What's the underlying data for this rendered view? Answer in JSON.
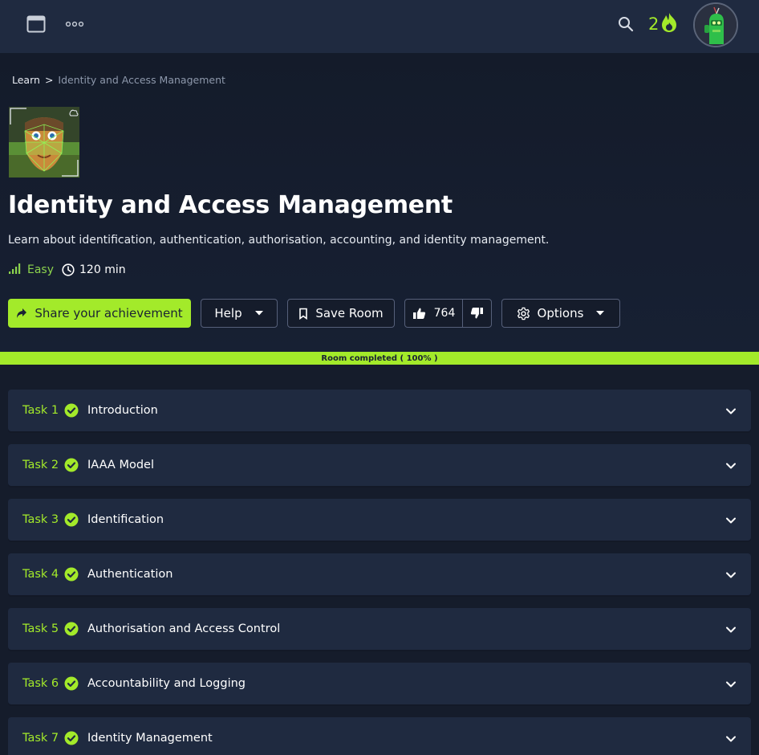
{
  "header": {
    "streak_count": "2"
  },
  "breadcrumb": {
    "root": "Learn",
    "separator": ">",
    "current": "Identity and Access Management"
  },
  "room": {
    "title": "Identity and Access Management",
    "description": "Learn about identification, authentication, authorisation, accounting, and identity management.",
    "difficulty": "Easy",
    "duration": "120 min"
  },
  "actions": {
    "share_label": "Share your achievement",
    "help_label": "Help",
    "save_label": "Save Room",
    "upvotes": "764",
    "options_label": "Options"
  },
  "progress": {
    "label": "Room completed ( 100% )",
    "percent": 100
  },
  "tasks": [
    {
      "num": "Task 1",
      "title": "Introduction"
    },
    {
      "num": "Task 2",
      "title": "IAAA Model"
    },
    {
      "num": "Task 3",
      "title": "Identification"
    },
    {
      "num": "Task 4",
      "title": "Authentication"
    },
    {
      "num": "Task 5",
      "title": "Authorisation and Access Control"
    },
    {
      "num": "Task 6",
      "title": "Accountability and Logging"
    },
    {
      "num": "Task 7",
      "title": "Identity Management"
    }
  ],
  "colors": {
    "accent": "#a3ea2a",
    "background": "#151c2b",
    "card": "#1f2a40",
    "difficulty_easy": "#8bd24d"
  },
  "icons": {
    "window": "browser-window-icon",
    "more": "more-dots-icon",
    "search": "search-icon",
    "streak": "flame-icon",
    "share": "share-arrow-icon",
    "help_caret": "caret-down-icon",
    "save": "bookmark-icon",
    "upvote": "thumbs-up-icon",
    "downvote": "thumbs-down-icon",
    "options": "gear-icon",
    "difficulty": "signal-bars-icon",
    "duration": "clock-icon",
    "task_done": "check-circle-icon",
    "task_expand": "chevron-down-icon"
  }
}
